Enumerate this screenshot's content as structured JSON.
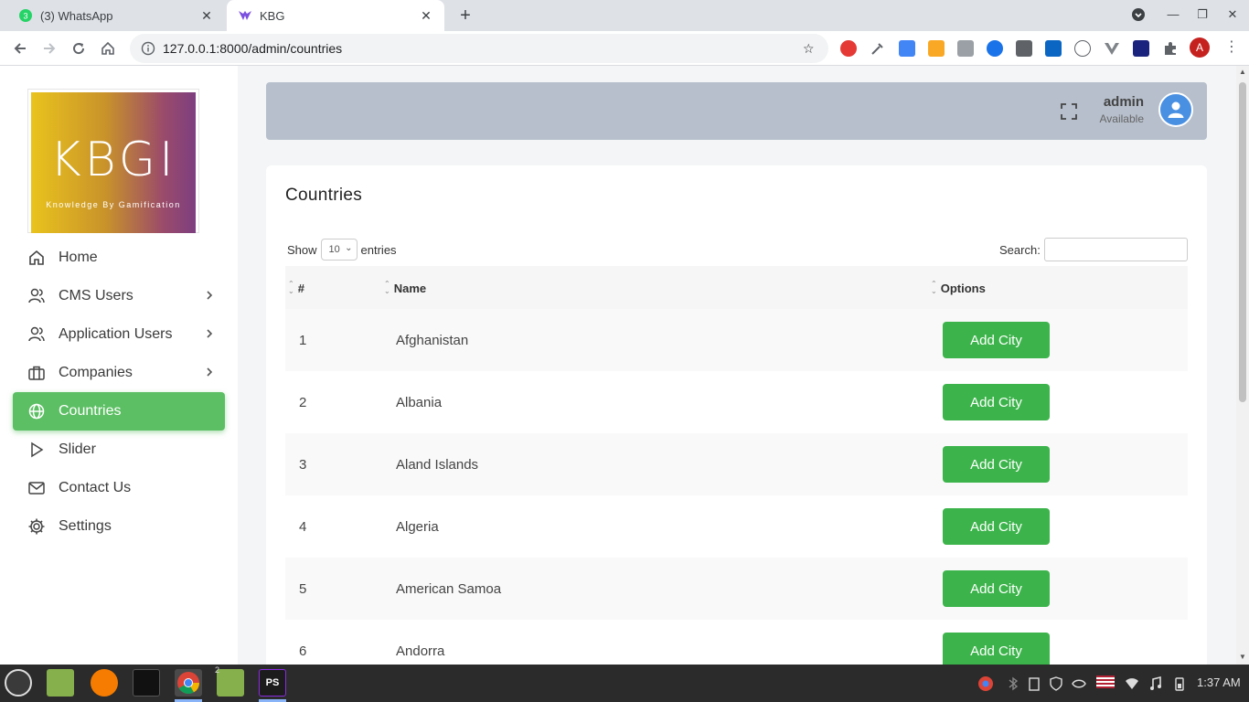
{
  "browser": {
    "tabs": [
      {
        "title": "(3) WhatsApp",
        "favicon_badge": "3"
      },
      {
        "title": "KBG"
      }
    ],
    "url": "127.0.0.1:8000/admin/countries",
    "profile_initial": "A"
  },
  "sidebar": {
    "logo_text": "KBGI",
    "logo_subtitle": "Knowledge By Gamification",
    "items": [
      {
        "label": "Home",
        "icon": "home-icon",
        "has_submenu": false
      },
      {
        "label": "CMS Users",
        "icon": "users-icon",
        "has_submenu": true
      },
      {
        "label": "Application Users",
        "icon": "users-icon",
        "has_submenu": true
      },
      {
        "label": "Companies",
        "icon": "briefcase-icon",
        "has_submenu": true
      },
      {
        "label": "Countries",
        "icon": "globe-icon",
        "has_submenu": false,
        "active": true
      },
      {
        "label": "Slider",
        "icon": "play-icon",
        "has_submenu": false
      },
      {
        "label": "Contact Us",
        "icon": "mail-icon",
        "has_submenu": false
      },
      {
        "label": "Settings",
        "icon": "gear-icon",
        "has_submenu": false
      }
    ]
  },
  "header": {
    "username": "admin",
    "status": "Available"
  },
  "main": {
    "title": "Countries",
    "show_label": "Show",
    "entries_value": "10",
    "entries_label": "entries",
    "search_label": "Search:",
    "search_value": "",
    "columns": [
      "#",
      "Name",
      "Options"
    ],
    "rows": [
      {
        "num": "1",
        "name": "Afghanistan",
        "action": "Add City"
      },
      {
        "num": "2",
        "name": "Albania",
        "action": "Add City"
      },
      {
        "num": "3",
        "name": "Aland Islands",
        "action": "Add City"
      },
      {
        "num": "4",
        "name": "Algeria",
        "action": "Add City"
      },
      {
        "num": "5",
        "name": "American Samoa",
        "action": "Add City"
      },
      {
        "num": "6",
        "name": "Andorra",
        "action": "Add City"
      }
    ]
  },
  "taskbar": {
    "clock": "1:37 AM",
    "workspace_badge": "2"
  },
  "colors": {
    "accent_green": "#3cb44b",
    "active_nav": "#5cbf64",
    "header_bar": "#b6bfcb"
  }
}
